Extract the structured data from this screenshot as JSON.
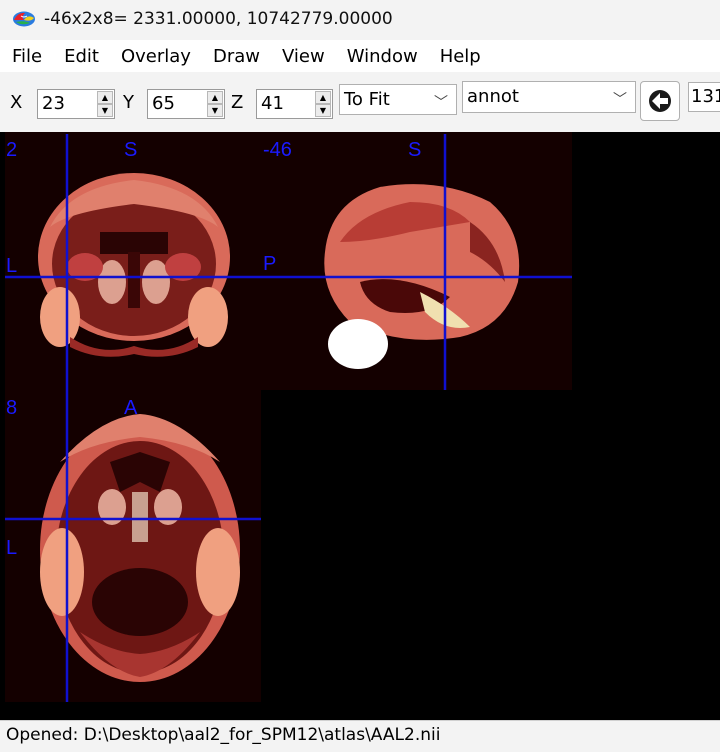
{
  "window": {
    "title": "-46x2x8= 2331.00000, 10742779.00000",
    "app_icon": "mricron-brain-icon"
  },
  "menu": {
    "items": [
      "File",
      "Edit",
      "Overlay",
      "Draw",
      "View",
      "Window",
      "Help"
    ]
  },
  "toolbar": {
    "x_label": "X",
    "x_value": "23",
    "y_label": "Y",
    "y_value": "65",
    "z_label": "Z",
    "z_value": "41",
    "zoom_value": "To Fit",
    "colormap_value": "annot",
    "right_value": "131",
    "rotate_icon": "rotate-arrow-icon"
  },
  "views": {
    "coronal": {
      "slice": "2",
      "top": "S",
      "left": "L"
    },
    "sagittal": {
      "slice": "-46",
      "top": "S",
      "left": "P"
    },
    "axial": {
      "slice": "8",
      "top": "A",
      "left": "L"
    }
  },
  "colors": {
    "crosshair": "#1010d0",
    "label": "#1a1aff",
    "background": "#000000"
  },
  "status": {
    "text": "Opened: D:\\Desktop\\aal2_for_SPM12\\atlas\\AAL2.nii"
  }
}
